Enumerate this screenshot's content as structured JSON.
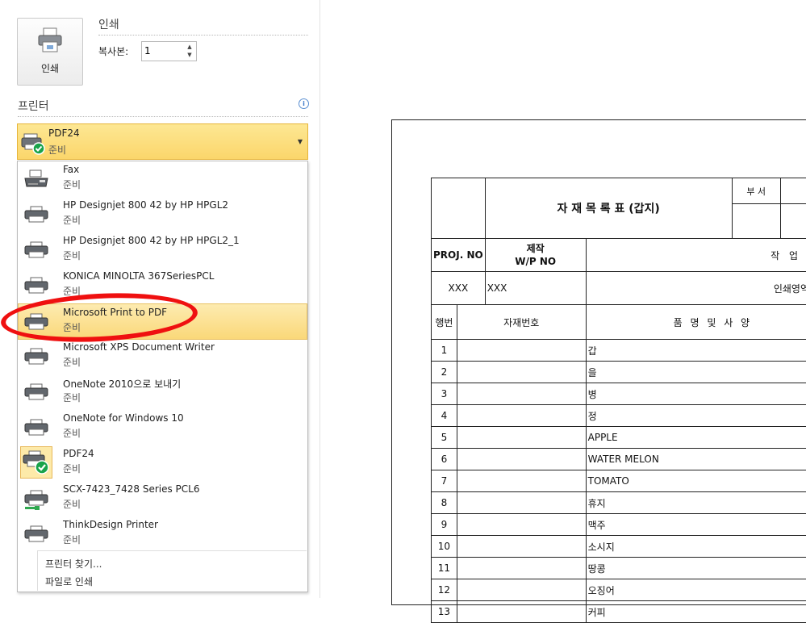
{
  "print_section": {
    "title": "인쇄",
    "button_label": "인쇄",
    "copies_label": "복사본:",
    "copies_value": "1"
  },
  "printer_section": {
    "title": "프린터",
    "info_icon": "info-icon",
    "selected": {
      "name": "PDF24",
      "status": "준비"
    },
    "items": [
      {
        "name": "Fax",
        "status": "준비",
        "icon": "fax-icon"
      },
      {
        "name": "HP Designjet 800 42 by HP HPGL2",
        "status": "준비",
        "icon": "printer-icon"
      },
      {
        "name": "HP Designjet 800 42 by HP HPGL2_1",
        "status": "준비",
        "icon": "printer-icon"
      },
      {
        "name": "KONICA MINOLTA 367SeriesPCL",
        "status": "준비",
        "icon": "printer-icon"
      },
      {
        "name": "Microsoft Print to PDF",
        "status": "준비",
        "icon": "printer-icon"
      },
      {
        "name": "Microsoft XPS Document Writer",
        "status": "준비",
        "icon": "printer-icon"
      },
      {
        "name": "OneNote 2010으로 보내기",
        "status": "준비",
        "icon": "printer-icon"
      },
      {
        "name": "OneNote for Windows 10",
        "status": "준비",
        "icon": "printer-icon"
      },
      {
        "name": "PDF24",
        "status": "준비",
        "icon": "printer-default-icon"
      },
      {
        "name": "SCX-7423_7428 Series PCL6",
        "status": "준비",
        "icon": "network-printer-icon"
      },
      {
        "name": "ThinkDesign Printer",
        "status": "준비",
        "icon": "printer-icon"
      }
    ],
    "find_printer_label": "프린터 찾기...",
    "print_to_file_label": "파일로 인쇄"
  },
  "preview": {
    "title": "자 재 목 록 표 (갑지)",
    "dept_label": "부 서",
    "proj_no_label": "PROJ. NO",
    "wp_no_label_1": "제작",
    "wp_no_label_2": "W/P NO",
    "work_label": "작 업",
    "proj_no_value": "XXX",
    "wp_no_value": "XXX",
    "work_value": "인쇄영역",
    "row_no_label": "행번",
    "material_no_label": "자재번호",
    "spec_label": "품 명 및 사 양",
    "rows": [
      {
        "no": "1",
        "spec": "갑"
      },
      {
        "no": "2",
        "spec": "을"
      },
      {
        "no": "3",
        "spec": "병"
      },
      {
        "no": "4",
        "spec": "정"
      },
      {
        "no": "5",
        "spec": "APPLE"
      },
      {
        "no": "6",
        "spec": "WATER MELON"
      },
      {
        "no": "7",
        "spec": "TOMATO"
      },
      {
        "no": "8",
        "spec": "휴지"
      },
      {
        "no": "9",
        "spec": "맥주"
      },
      {
        "no": "10",
        "spec": "소시지"
      },
      {
        "no": "11",
        "spec": "땅콩"
      },
      {
        "no": "12",
        "spec": "오징어"
      },
      {
        "no": "13",
        "spec": "커피"
      }
    ]
  },
  "colors": {
    "selection": "#fad879",
    "annotation": "#ef1010"
  }
}
